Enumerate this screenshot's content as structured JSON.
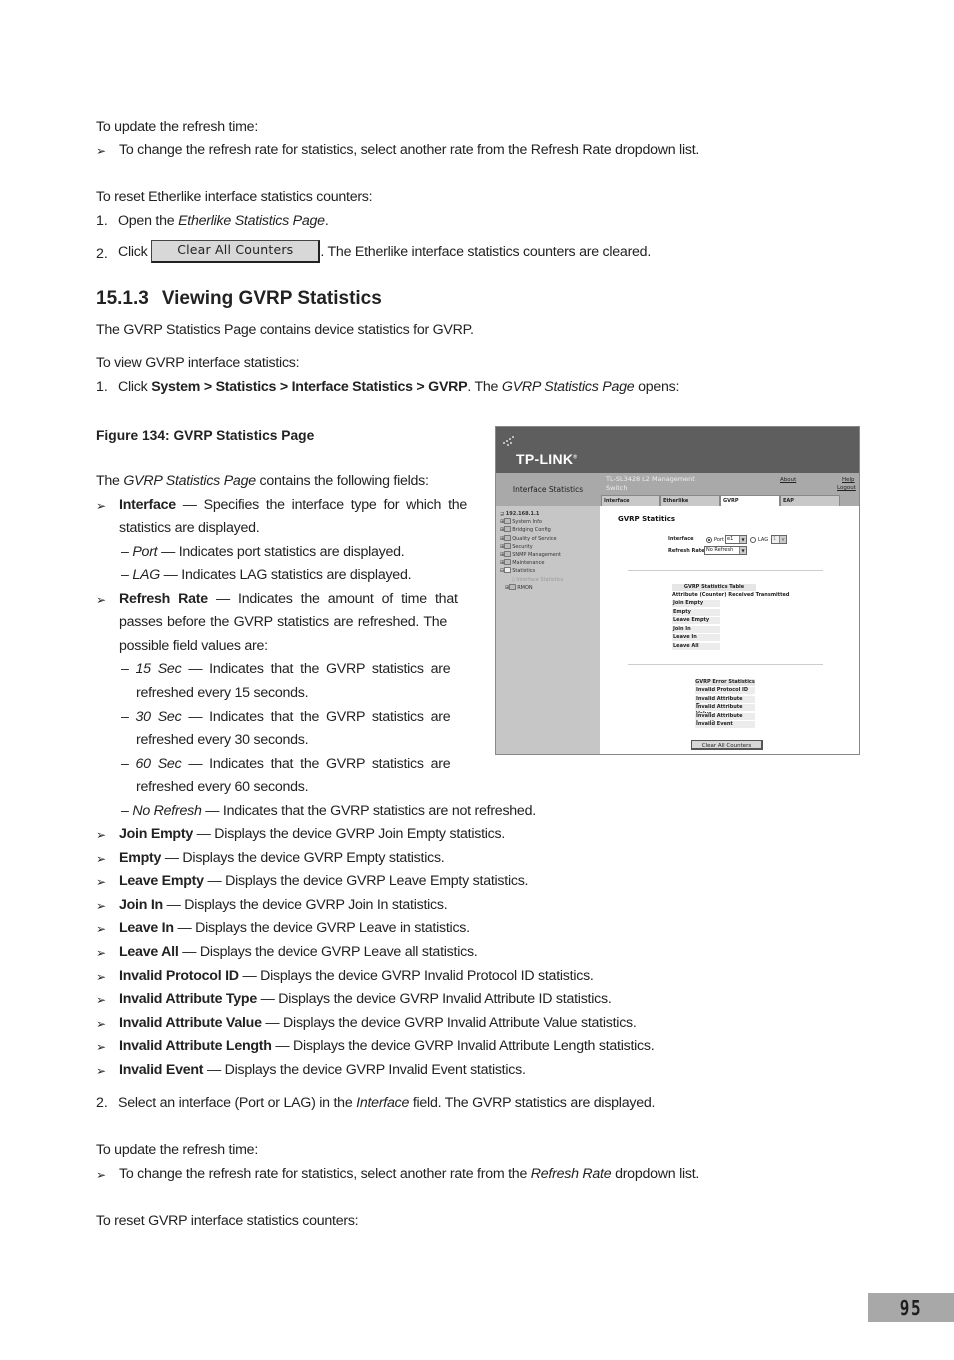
{
  "intro": {
    "update_heading": "To update the refresh time:",
    "update_bullet": "To change the refresh rate for statistics, select another rate from the Refresh Rate dropdown list.",
    "reset_heading": "To reset Etherlike interface statistics counters:",
    "step1_num": "1.",
    "step1_pre": "Open the ",
    "step1_em": "Etherlike Statistics Page",
    "step1_post": ".",
    "step2_num": "2.",
    "step2_pre": "Click ",
    "step2_button": "Clear All Counters",
    "step2_post": ". The Etherlike interface statistics counters are cleared."
  },
  "section": {
    "number": "15.1.3",
    "title": "Viewing GVRP Statistics",
    "description": "The GVRP Statistics Page contains device statistics for GVRP.",
    "view_heading": "To view GVRP interface statistics:",
    "step1_num": "1.",
    "step1_pre": "Click ",
    "step1_path": "System > Statistics > Interface Statistics > GVRP",
    "step1_mid": ". The ",
    "step1_em": "GVRP Statistics Page",
    "step1_post": " opens:"
  },
  "figure": {
    "caption": "Figure 134: GVRP Statistics Page",
    "screenshot": {
      "logo": "TP-LINK",
      "left_title": "Interface Statistics",
      "product": "TL-SL3428 L2 Management Switch",
      "about": "About",
      "help": "Help",
      "logout": "Logout",
      "tabs": [
        {
          "label": "Interface",
          "active": false
        },
        {
          "label": "Etherlike",
          "active": false
        },
        {
          "label": "GVRP",
          "active": true
        },
        {
          "label": "EAP",
          "active": false
        }
      ],
      "tree": [
        {
          "label": "192.168.1.1",
          "level": 0
        },
        {
          "label": "System Info",
          "level": 1
        },
        {
          "label": "Bridging Config",
          "level": 1
        },
        {
          "label": "Quality of Service",
          "level": 1
        },
        {
          "label": "Security",
          "level": 1
        },
        {
          "label": "SNMP Management",
          "level": 1
        },
        {
          "label": "Maintenance",
          "level": 1
        },
        {
          "label": "Statistics",
          "level": 1
        },
        {
          "label": "Interface Statistics",
          "level": 2
        },
        {
          "label": "RMON",
          "level": 2
        }
      ],
      "page_title": "GVRP Statitics",
      "interface_label": "Interface",
      "port_label": "Port",
      "port_value": "e1",
      "lag_label": "LAG",
      "lag_value": "1",
      "refresh_label": "Refresh Rate",
      "refresh_value": "No Refresh",
      "stats_table": {
        "title": "GVRP Statistics Table",
        "columns": [
          "Attribute (Counter)",
          "Received",
          "Transmitted"
        ],
        "rows": [
          "Join Empty",
          "Empty",
          "Leave Empty",
          "Join In",
          "Leave In",
          "Leave All"
        ]
      },
      "error_table": {
        "title": "GVRP Error Statistics",
        "rows": [
          "Invalid Protocol ID",
          "Invalid Attribute Type",
          "Invalid Attribute Value",
          "Invalid Attribute Length",
          "Invalid Event"
        ]
      },
      "clear_button": "Clear All Counters"
    }
  },
  "fields": {
    "intro_pre": "The ",
    "intro_em": "GVRP Statistics Page",
    "intro_post": " contains the following fields:",
    "interface": {
      "name": "Interface",
      "desc_line1": " — Specifies the interface type for which the",
      "desc_line2": "statistics are displayed.",
      "sub": [
        {
          "em": "Port",
          "text": " — Indicates port statistics are displayed."
        },
        {
          "em": "LAG",
          "text": " — Indicates LAG statistics are displayed."
        }
      ]
    },
    "refresh": {
      "name": "Refresh Rate",
      "desc_line1": " — Indicates the amount of time that",
      "desc_line2": "passes before the GVRP statistics are refreshed. The",
      "desc_line3": "possible field values are:",
      "sub": [
        {
          "em": "15 Sec",
          "line1": " — Indicates that the GVRP statistics are",
          "line2": "refreshed every 15 seconds."
        },
        {
          "em": "30 Sec",
          "line1": " — Indicates that the GVRP statistics are",
          "line2": "refreshed every 30 seconds."
        },
        {
          "em": "60 Sec",
          "line1": " — Indicates that the GVRP statistics are",
          "line2": "refreshed every 60 seconds."
        }
      ],
      "no_refresh_em": "No Refresh",
      "no_refresh_text": " — Indicates that the GVRP statistics are not refreshed."
    },
    "list": [
      {
        "name": "Join Empty",
        "desc": " — Displays the device GVRP Join Empty statistics."
      },
      {
        "name": "Empty",
        "desc": " — Displays the device GVRP Empty statistics."
      },
      {
        "name": "Leave Empty",
        "desc": " — Displays the device GVRP Leave Empty statistics."
      },
      {
        "name": "Join In",
        "desc": " — Displays the device GVRP Join In statistics."
      },
      {
        "name": "Leave In",
        "desc": " — Displays the device GVRP Leave in statistics."
      },
      {
        "name": "Leave All",
        "desc": " — Displays the device GVRP Leave all statistics."
      },
      {
        "name": "Invalid Protocol ID",
        "desc": " — Displays the device GVRP Invalid Protocol ID statistics."
      },
      {
        "name": "Invalid Attribute Type",
        "desc": " — Displays the device GVRP Invalid Attribute ID statistics."
      },
      {
        "name": "Invalid Attribute Value",
        "desc": " — Displays the device GVRP Invalid Attribute Value statistics."
      },
      {
        "name": "Invalid Attribute Length",
        "desc": " — Displays the device GVRP Invalid Attribute Length statistics."
      },
      {
        "name": "Invalid Event",
        "desc": " — Displays the device GVRP Invalid Event statistics."
      }
    ]
  },
  "after": {
    "step2_num": "2.",
    "step2_pre": "Select an interface (Port or LAG) in the ",
    "step2_em": "Interface",
    "step2_post": " field. The GVRP statistics are displayed.",
    "update_heading": "To update the refresh time:",
    "update_pre": "To change the refresh rate for statistics, select another rate from the ",
    "update_em": "Refresh Rate",
    "update_post": " dropdown list.",
    "reset_heading": "To reset GVRP interface statistics counters:"
  },
  "page_number": "95",
  "bullet_glyph": "➢"
}
